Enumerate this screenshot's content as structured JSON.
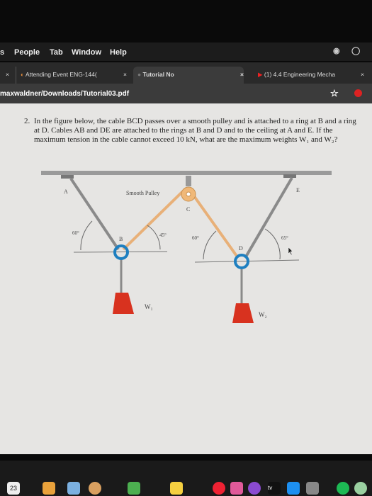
{
  "menubar": {
    "items": [
      "s",
      "People",
      "Tab",
      "Window",
      "Help"
    ]
  },
  "tabs": [
    {
      "title": "Attending Event ENG-144(",
      "close": "×"
    },
    {
      "title": "Tutorial No",
      "close": "×",
      "active": true
    },
    {
      "title": "(1) 4.4 Engineering Mecha",
      "close": "×"
    }
  ],
  "tab_left_close": "×",
  "address": "maxwaldner/Downloads/Tutorial03.pdf",
  "question": {
    "number": "2.",
    "text": "In the figure below, the cable BCD passes over a smooth pulley and is attached to a ring at B and a ring at D. Cables AB and DE are attached to the rings at B and D and to the ceiling at A and E. If the maximum tension in the cable cannot exceed 10 kN, what are the maximum weights W₁ and W₂?"
  },
  "figure": {
    "labels": {
      "A": "A",
      "B": "B",
      "C": "C",
      "D": "D",
      "E": "E",
      "pulley": "Smooth Pulley",
      "w1": "W₁",
      "w2": "W₂"
    },
    "angles": {
      "AB": "60°",
      "BC": "45°",
      "CD": "60°",
      "DE": "65°"
    },
    "colors": {
      "ring": "#1e7fc0",
      "weight": "#d8321f",
      "rope_bcd": "#e8b078",
      "rope_steel": "#8a8a8a"
    }
  },
  "dock": {
    "calendar_day": "23"
  }
}
